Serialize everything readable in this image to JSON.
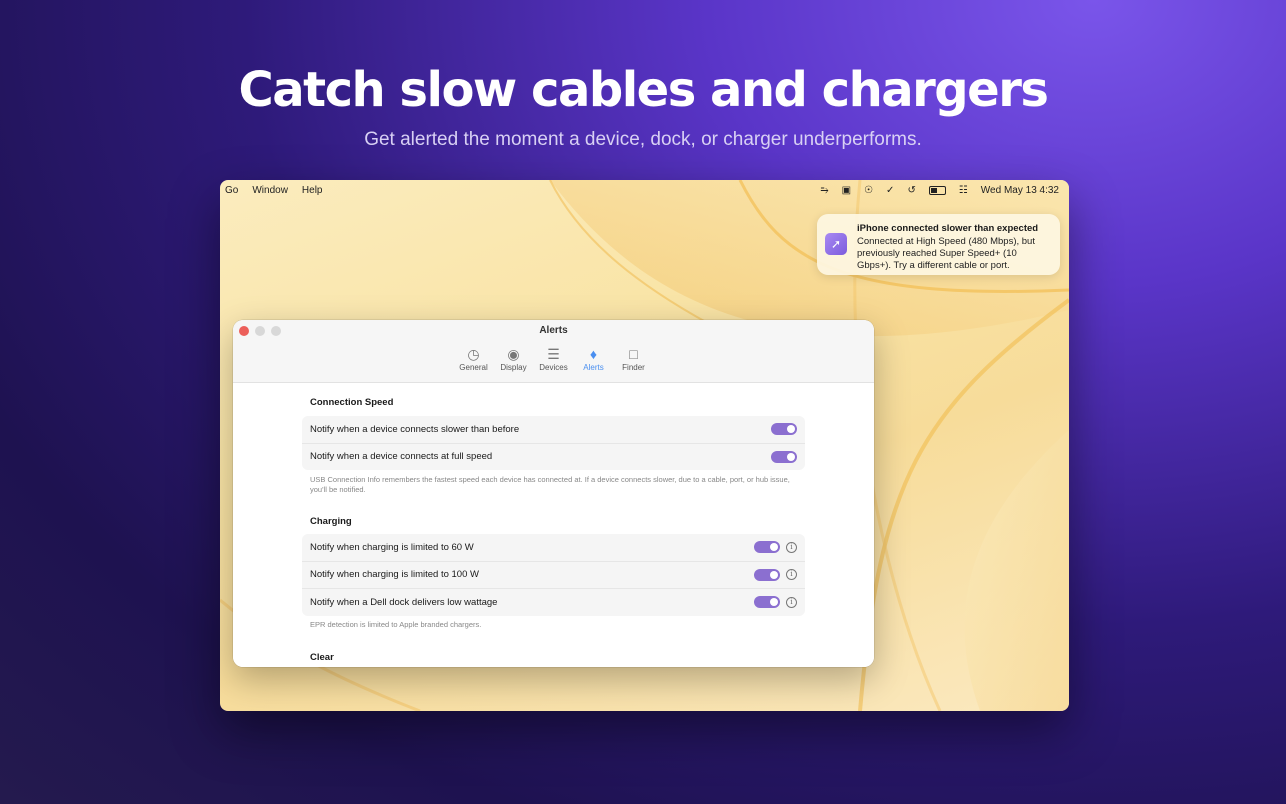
{
  "hero": {
    "title": "Catch slow cables and chargers",
    "subtitle": "Get alerted the moment a device, dock, or charger underperforms."
  },
  "menubar": {
    "menus": [
      "Go",
      "Window",
      "Help"
    ],
    "status_icons": [
      "waveform-icon",
      "display-icon",
      "globe-icon",
      "usb-plug-icon",
      "time-machine-icon",
      "battery-icon",
      "control-center-icon"
    ],
    "clock": "Wed May 13  4:32"
  },
  "notification": {
    "icon": "usb-cable-icon",
    "title": "iPhone connected slower than expected",
    "body": "Connected at High Speed (480 Mbps), but previously reached Super Speed+ (10 Gbps+). Try a different cable or port."
  },
  "window": {
    "title": "Alerts",
    "tabs": [
      {
        "label": "General",
        "icon": "gauge-icon",
        "active": false
      },
      {
        "label": "Display",
        "icon": "eye-icon",
        "active": false
      },
      {
        "label": "Devices",
        "icon": "sliders-icon",
        "active": false
      },
      {
        "label": "Alerts",
        "icon": "bell-icon",
        "active": true
      },
      {
        "label": "Finder",
        "icon": "folder-icon",
        "active": false
      }
    ],
    "sections": {
      "connection_speed": {
        "title": "Connection Speed",
        "rows": [
          {
            "label": "Notify when a device connects slower than before",
            "on": true
          },
          {
            "label": "Notify when a device connects at full speed",
            "on": true
          }
        ],
        "note": "USB Connection Info remembers the fastest speed each device has connected at. If a device connects slower, due to a cable, port, or hub issue, you'll be notified."
      },
      "charging": {
        "title": "Charging",
        "rows": [
          {
            "label": "Notify when charging is limited to 60 W",
            "on": true
          },
          {
            "label": "Notify when charging is limited to 100 W",
            "on": true
          },
          {
            "label": "Notify when a Dell dock delivers low wattage",
            "on": true
          }
        ],
        "note": "EPR detection is limited to Apple branded chargers."
      },
      "clear": {
        "title": "Clear"
      }
    }
  },
  "colors": {
    "accent_toggle": "#8b6fd0",
    "active_tab": "#4a8ff0",
    "close_button": "#ec5f5a"
  }
}
